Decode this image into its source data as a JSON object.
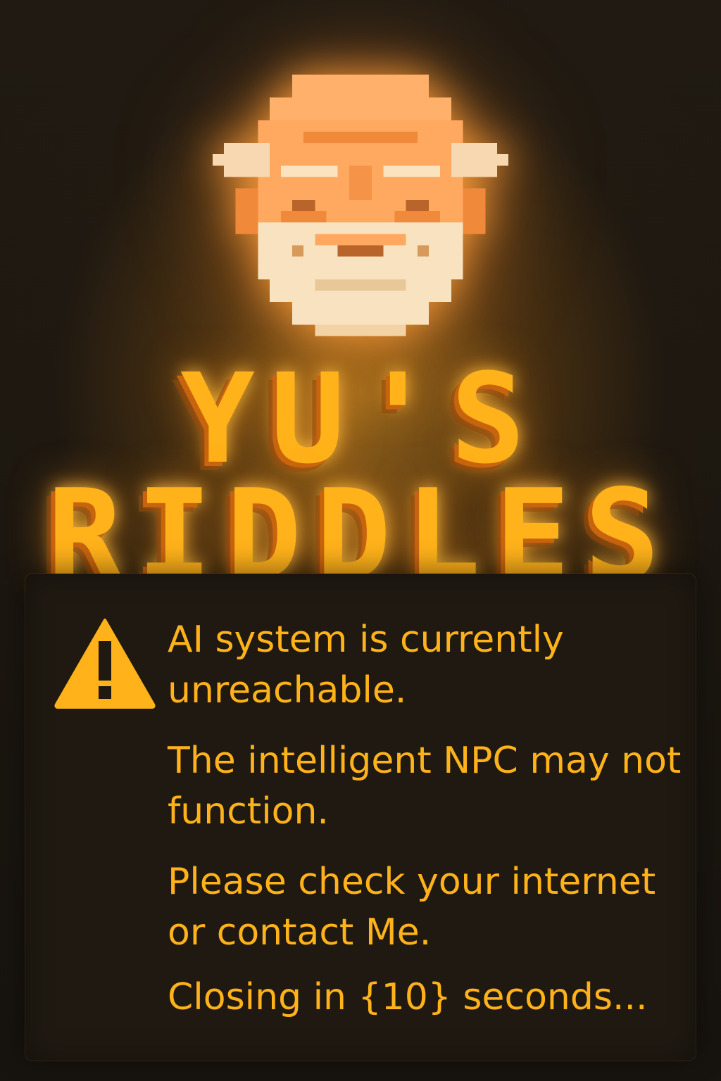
{
  "title": {
    "line1": "YU'S",
    "line2": "RIDDLES"
  },
  "portrait": {
    "icon": "old-sage-pixel-portrait"
  },
  "dialog": {
    "icon": "warning-triangle-icon",
    "messages": [
      "AI system is currently unreachable.",
      "The intelligent NPC may not function.",
      "Please check your internet or contact Me.",
      "Closing in {10} seconds..."
    ]
  },
  "colors": {
    "accent": "#ffb21a",
    "shadow": "#c9640e",
    "panel": "#1f1911",
    "background": "#1a1410"
  }
}
